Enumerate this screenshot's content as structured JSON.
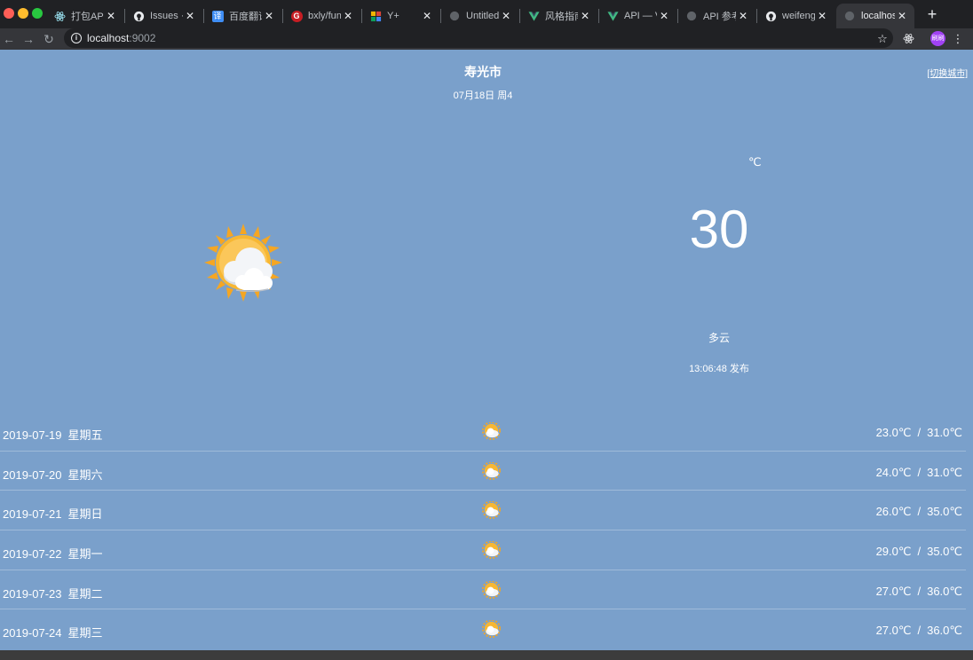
{
  "browser": {
    "tabs": [
      {
        "title": "打包APK",
        "favicon": "electron-icon"
      },
      {
        "title": "Issues · n",
        "favicon": "github-icon"
      },
      {
        "title": "百度翻译",
        "favicon": "baidu-translate-icon"
      },
      {
        "title": "bxly/fun_c",
        "favicon": "gitee-icon"
      },
      {
        "title": "Y+",
        "favicon": "grid-icon"
      },
      {
        "title": "Untitled D",
        "favicon": "globe-icon"
      },
      {
        "title": "风格指南 -",
        "favicon": "vue-icon"
      },
      {
        "title": "API — Vue",
        "favicon": "vue-icon"
      },
      {
        "title": "API 参考 |",
        "favicon": "globe-icon"
      },
      {
        "title": "weifengz",
        "favicon": "github-icon"
      },
      {
        "title": "localhost",
        "favicon": "globe-icon"
      }
    ],
    "url_host": "localhost",
    "url_port": ":9002",
    "avatar_text": "刷刷"
  },
  "weather": {
    "city": "寿光市",
    "date": "07月18日 周4",
    "switch_city": "[切换城市]",
    "unit": "℃",
    "temperature": "30",
    "condition": "多云",
    "published": "13:06:48 发布",
    "icon": "partly-cloudy-icon"
  },
  "forecast": [
    {
      "date": "2019-07-19",
      "weekday": "星期五",
      "range": [
        "23.0℃",
        "31.0℃"
      ]
    },
    {
      "date": "2019-07-20",
      "weekday": "星期六",
      "range": [
        "24.0℃",
        "31.0℃"
      ]
    },
    {
      "date": "2019-07-21",
      "weekday": "星期日",
      "range": [
        "26.0℃",
        "35.0℃"
      ]
    },
    {
      "date": "2019-07-22",
      "weekday": "星期一",
      "range": [
        "29.0℃",
        "35.0℃"
      ]
    },
    {
      "date": "2019-07-23",
      "weekday": "星期二",
      "range": [
        "27.0℃",
        "36.0℃"
      ]
    },
    {
      "date": "2019-07-24",
      "weekday": "星期三",
      "range": [
        "27.0℃",
        "36.0℃"
      ]
    }
  ],
  "colors": {
    "page_background": "#7aa0cb",
    "sun": "#f5a623",
    "cloud": "#f2f4f7"
  }
}
